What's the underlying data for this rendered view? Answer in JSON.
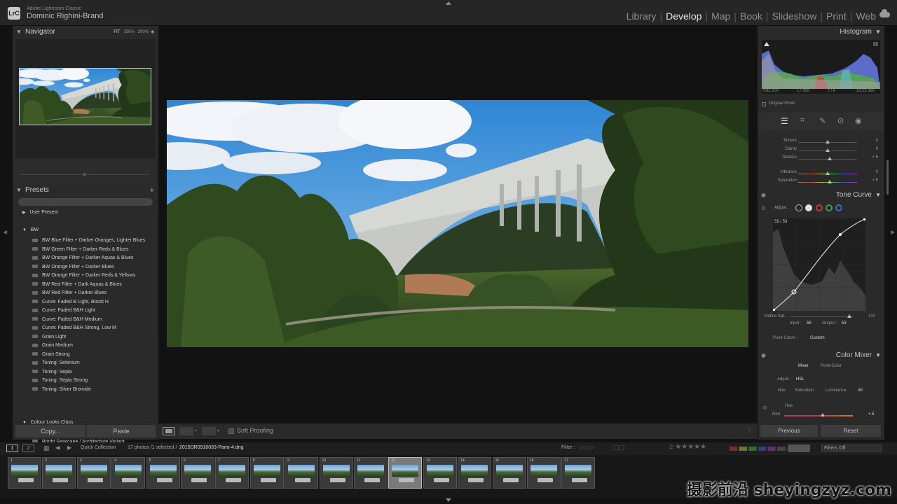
{
  "app": {
    "name": "Adobe Lightroom Classic",
    "user": "Dominic Righini-Brand",
    "logo": "LrC"
  },
  "modules": [
    {
      "label": "Library",
      "active": false
    },
    {
      "label": "Develop",
      "active": true
    },
    {
      "label": "Map",
      "active": false
    },
    {
      "label": "Book",
      "active": false
    },
    {
      "label": "Slideshow",
      "active": false
    },
    {
      "label": "Print",
      "active": false
    },
    {
      "label": "Web",
      "active": false
    }
  ],
  "navigator": {
    "title": "Navigator",
    "zoom_options": [
      "FIT",
      "100%",
      "200%"
    ]
  },
  "presets": {
    "title": "Presets",
    "user_presets": "User Presets",
    "group_bw": "BW",
    "bw_items": [
      "BW Blue Filter + Darker Oranges, Lighter Blues",
      "BW Green Filter + Darker Reds & Blues",
      "BW Orange Filter + Darker Aquas & Blues",
      "BW Orange Filter + Darker Blues",
      "BW Orange Filter + Darker Reds & Yellows",
      "BW Red Filter + Dark Aquas & Blues",
      "BW Red Filter + Darker Blues",
      "Curve: Faded B Light, Boost H",
      "Curve: Faded B&H Light",
      "Curve: Faded B&H Medium",
      "Curve: Faded B&H Strong, Low M",
      "Grain Light",
      "Grain Medium",
      "Grain Strong",
      "Toning: Selenium",
      "Toning: Sepia",
      "Toning: Sepia Strong",
      "Toning: Silver Bromide"
    ],
    "group_colour": "Colour Looks Class",
    "colour_items": [
      "Bright Seascape",
      "Bright Seascape / Architecture Variant"
    ]
  },
  "left_buttons": {
    "copy": "Copy...",
    "paste": "Paste"
  },
  "toolbar": {
    "soft_proofing": "Soft Proofing"
  },
  "histogram": {
    "title": "Histogram",
    "iso": "ISO 200",
    "focal": "17 mm",
    "aperture": "f / 8",
    "shutter": "1/125 sec",
    "original_photo": "Original Photo"
  },
  "basic_sliders": [
    {
      "label": "Texture",
      "value": "0",
      "pos": 0.5,
      "color": "gray"
    },
    {
      "label": "Clarity",
      "value": "0",
      "pos": 0.5,
      "color": "gray"
    },
    {
      "label": "Dehaze",
      "value": "+ 5",
      "pos": 0.53,
      "color": "gray"
    },
    {
      "label": "Vibrance",
      "value": "0",
      "pos": 0.5,
      "color": "rainbow"
    },
    {
      "label": "Saturation",
      "value": "+ 5",
      "pos": 0.53,
      "color": "rainbow"
    }
  ],
  "tone_curve": {
    "title": "Tone Curve",
    "adjust": "Adjust :",
    "readout": "59 / 53",
    "refine_sat": "Refine Sat.",
    "refine_value": "100",
    "input_label": "Input :",
    "input_value": "59",
    "output_label": "Output :",
    "output_value": "53",
    "point_curve_label": "Point Curve :",
    "point_curve_value": "Custom"
  },
  "color_mixer": {
    "title": "Color Mixer",
    "tabs": [
      "Mixer",
      "Point Color"
    ],
    "adjust_label": "Adjust :",
    "adjust_value": "HSL",
    "subtabs": [
      "Hue",
      "Saturation",
      "Luminance",
      "All"
    ],
    "section": "Hue",
    "red_label": "Red",
    "red_value": "+ 5"
  },
  "right_buttons": {
    "previous": "Previous",
    "reset": "Reset"
  },
  "filmbar": {
    "view1": "1",
    "view2": "2",
    "collection": "Quick Collection",
    "info": "17 photos /1 selected /",
    "filename": "2015DR0910033-Pano-4.dng",
    "filter_label": "Filter :",
    "filters_off": "Filters Off"
  },
  "filmstrip": {
    "numbers": [
      "1",
      "2",
      "3",
      "4",
      "5",
      "6",
      "7",
      "8",
      "9",
      "10",
      "11",
      "12",
      "13",
      "14",
      "15",
      "16",
      "17"
    ],
    "selected": 12
  },
  "watermark": "摄影前沿 sheyingzyz.com"
}
